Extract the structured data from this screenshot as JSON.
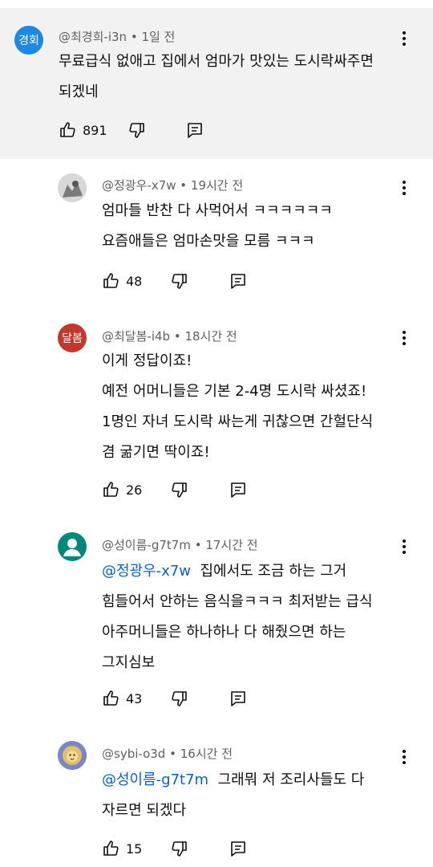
{
  "comments": [
    {
      "avatar_text": "경회",
      "avatar_color": "#1e88e5",
      "handle": "@최경희-i3n",
      "time": "1일 전",
      "lines": [
        "무료급식 없애고 집에서 엄마가 맛있는 도시락싸주면",
        "되겠네"
      ],
      "likes": "891"
    },
    {
      "avatar_text": "",
      "avatar_color": "#9e9e9e",
      "handle": "@정광우-x7w",
      "time": "19시간 전",
      "lines": [
        "엄마들 반찬 다 사먹어서 ㅋㅋㅋㅋㅋㅋ",
        "요즘애들은 엄마손맛을 모름 ㅋㅋㅋ"
      ],
      "likes": "48"
    },
    {
      "avatar_text": "달봄",
      "avatar_color": "#c0392b",
      "handle": "@최달봄-i4b",
      "time": "18시간 전",
      "lines": [
        "이게 정답이죠!",
        "예전 어머니들은 기본 2-4명 도시락 싸셨죠!",
        "1명인 자녀 도시락 싸는게 귀찮으면 간헐단식",
        "겸 굶기면 딱이죠!"
      ],
      "likes": "26"
    },
    {
      "avatar_text": "",
      "avatar_color": "#00897b",
      "handle": "@성이름-g7t7m",
      "time": "17시간 전",
      "mention": "@정광우-x7w",
      "lines": [
        "집에서도 조금 하는 그거",
        "힘들어서 안하는 음식을ㅋㅋㅋ 최저받는 급식",
        "아주머니들은 하나하나 다 해줬으면 하는",
        "그지심보"
      ],
      "likes": "43"
    },
    {
      "avatar_text": "",
      "avatar_color": "#5c6bc0",
      "handle": "@sybi-o3d",
      "time": "16시간 전",
      "mention": "@성이름-g7t7m",
      "lines": [
        "그래뭐 저 조리사들도 다",
        "자르면 되겠다"
      ],
      "likes": "15"
    }
  ]
}
